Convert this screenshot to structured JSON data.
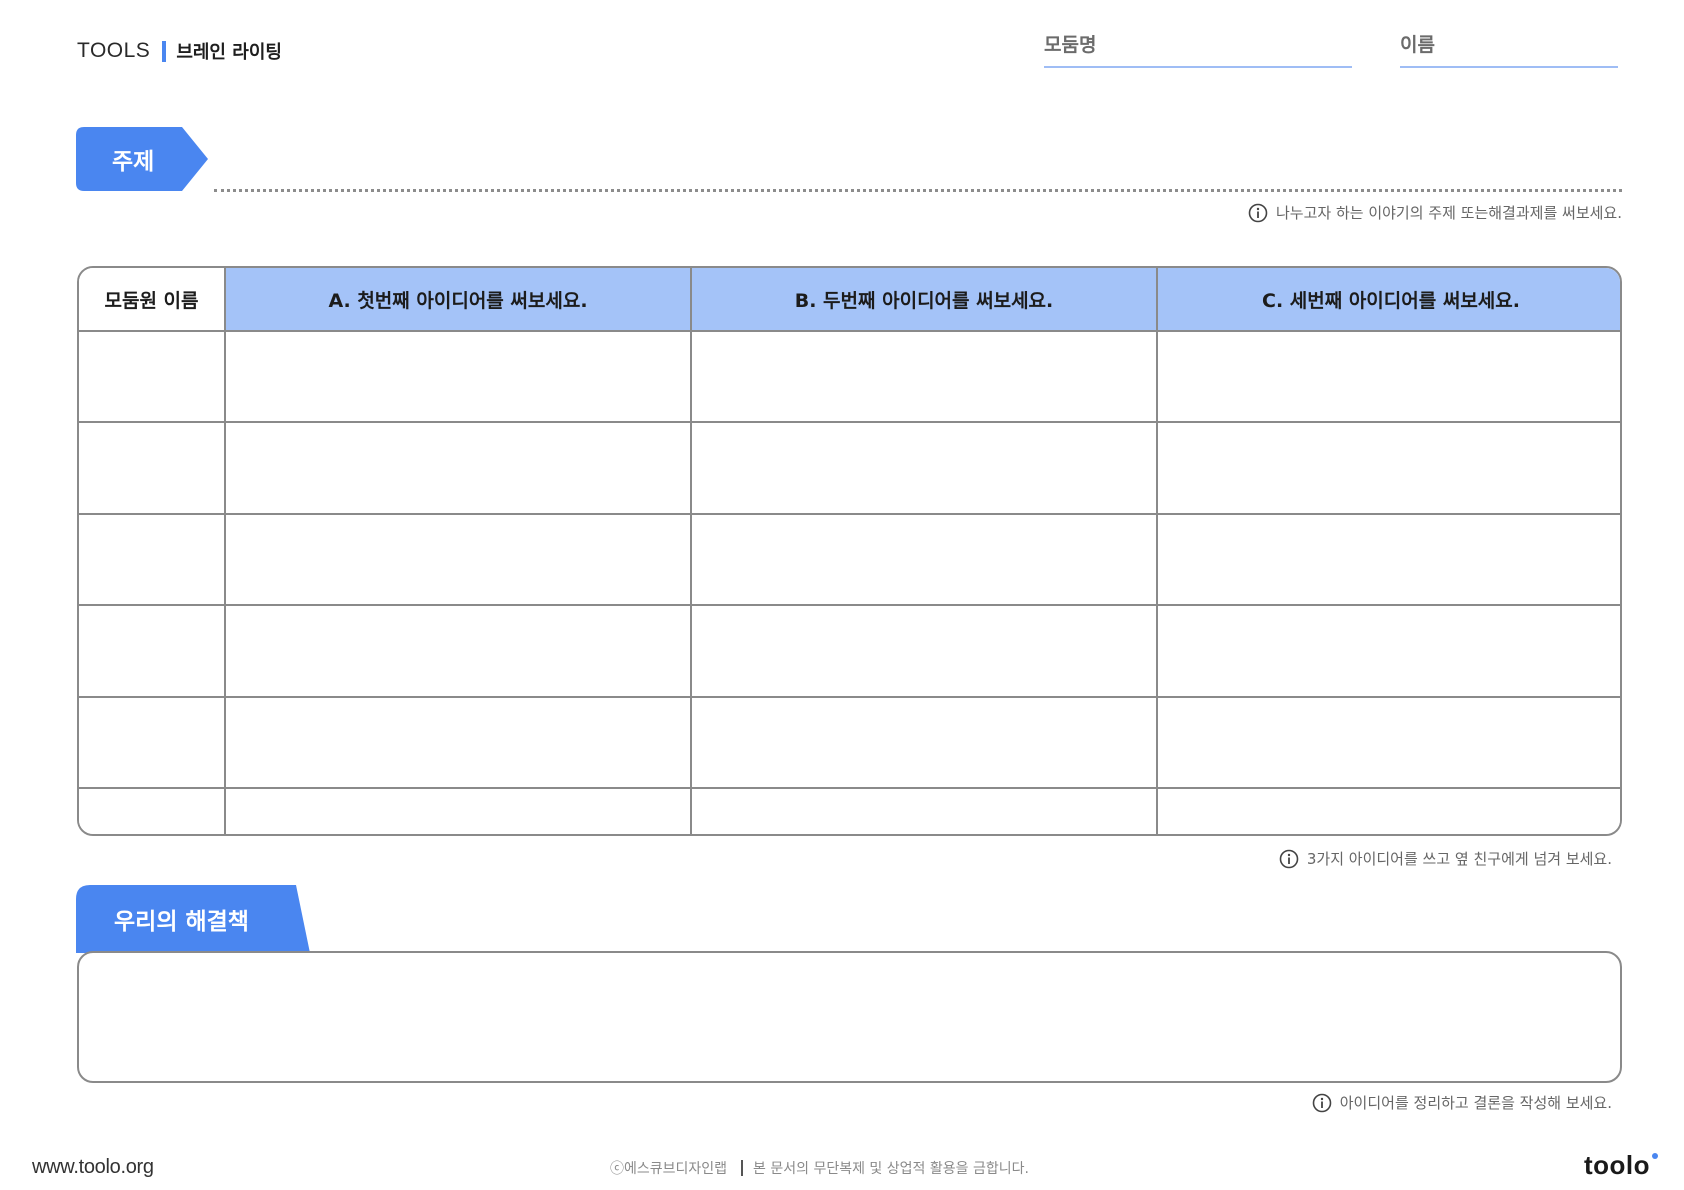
{
  "header": {
    "tools_label": "TOOLS",
    "tool_name": "브레인 라이팅",
    "group_field_label": "모둠명",
    "name_field_label": "이름"
  },
  "subject": {
    "label": "주제",
    "hint": "나누고자 하는 이야기의 주제 또는해결과제를 써보세요."
  },
  "table": {
    "member_header": "모둠원 이름",
    "column_headers": [
      "A. 첫번째 아이디어를 써보세요.",
      "B. 두번째 아이디어를 써보세요.",
      "C. 세번째 아이디어를 써보세요."
    ],
    "hint": "3가지 아이디어를 쓰고 옆 친구에게 넘겨 보세요."
  },
  "solution": {
    "label": "우리의 해결책",
    "hint": "아이디어를 정리하고 결론을 작성해 보세요."
  },
  "footer": {
    "url": "www.toolo.org",
    "copyright": "ⓒ에스큐브디자인랩",
    "notice": "본 문서의 무단복제 및 상업적 활용을 금합니다.",
    "logo": "toolo"
  },
  "colors": {
    "accent": "#4a86f0",
    "header_fill": "#a4c3f8",
    "field_underline": "#9fbdf5",
    "border": "#8a8a8a"
  },
  "icons": [
    "info-icon"
  ]
}
